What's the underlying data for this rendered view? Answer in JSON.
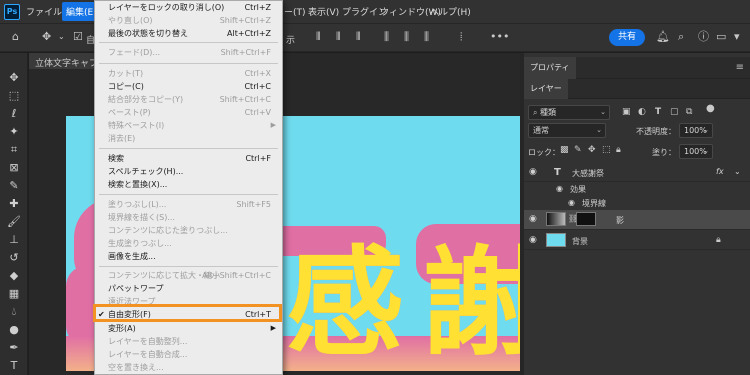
{
  "app": {
    "logo": "Ps"
  },
  "menubar": {
    "items": [
      "ファイル(F)",
      "編集(E)",
      "ー(T)",
      "表示(V)",
      "プラグイン",
      "ウィンドウ(W)",
      "ヘルプ(H)"
    ]
  },
  "options_bar": {
    "auto_label": "自",
    "show_label": "示",
    "share_label": "共有",
    "icons": [
      "home-icon",
      "move-icon",
      "checkbox-icon",
      "align-icons",
      "more-icon",
      "bell-icon",
      "search-icon",
      "help-icon",
      "workspace-icon",
      "panels-icon"
    ]
  },
  "document": {
    "tab_label": "立体文字キャプチ",
    "canvas_text": "感謝",
    "colors": {
      "background": "#6fdbee",
      "shape": "#e06fa4",
      "text": "#ffe033"
    }
  },
  "edit_menu": {
    "items": [
      {
        "label": "レイヤーをロックの取り消し(O)",
        "shortcut": "Ctrl+Z",
        "disabled": false
      },
      {
        "label": "やり直し(O)",
        "shortcut": "Shift+Ctrl+Z",
        "disabled": true
      },
      {
        "label": "最後の状態を切り替え",
        "shortcut": "Alt+Ctrl+Z",
        "disabled": false
      },
      {
        "label": "フェード(D)...",
        "shortcut": "Shift+Ctrl+F",
        "disabled": true
      },
      {
        "label": "カット(T)",
        "shortcut": "Ctrl+X",
        "disabled": true
      },
      {
        "label": "コピー(C)",
        "shortcut": "Ctrl+C",
        "disabled": false
      },
      {
        "label": "結合部分をコピー(Y)",
        "shortcut": "Shift+Ctrl+C",
        "disabled": true
      },
      {
        "label": "ペースト(P)",
        "shortcut": "Ctrl+V",
        "disabled": true
      },
      {
        "label": "特殊ペースト(I)",
        "shortcut": "",
        "disabled": true,
        "submenu": true
      },
      {
        "label": "消去(E)",
        "shortcut": "",
        "disabled": true
      },
      {
        "label": "検索",
        "shortcut": "Ctrl+F",
        "disabled": false
      },
      {
        "label": "スペルチェック(H)...",
        "shortcut": "",
        "disabled": false
      },
      {
        "label": "検索と置換(X)...",
        "shortcut": "",
        "disabled": false
      },
      {
        "label": "塗りつぶし(L)...",
        "shortcut": "Shift+F5",
        "disabled": true
      },
      {
        "label": "境界線を描く(S)...",
        "shortcut": "",
        "disabled": true
      },
      {
        "label": "コンテンツに応じた塗りつぶし...",
        "shortcut": "",
        "disabled": true
      },
      {
        "label": "生成塗りつぶし...",
        "shortcut": "",
        "disabled": true
      },
      {
        "label": "画像を生成...",
        "shortcut": "",
        "disabled": false
      },
      {
        "label": "コンテンツに応じて拡大・縮小",
        "shortcut": "Alt+Shift+Ctrl+C",
        "disabled": true
      },
      {
        "label": "パペットワープ",
        "shortcut": "",
        "disabled": false
      },
      {
        "label": "遠近法ワープ",
        "shortcut": "",
        "disabled": true
      },
      {
        "label": "自由変形(F)",
        "shortcut": "Ctrl+T",
        "disabled": false,
        "checked": true
      },
      {
        "label": "変形(A)",
        "shortcut": "",
        "disabled": false,
        "submenu": true
      },
      {
        "label": "レイヤーを自動整列...",
        "shortcut": "",
        "disabled": true
      },
      {
        "label": "レイヤーを自動合成...",
        "shortcut": "",
        "disabled": true
      },
      {
        "label": "空を置き換え...",
        "shortcut": "",
        "disabled": true
      }
    ],
    "highlight_color": "#f29223"
  },
  "properties_panel": {
    "tab_label": "プロパティ"
  },
  "layers_panel": {
    "tab_label": "レイヤー",
    "filter_value": "種類",
    "blend_mode": "通常",
    "opacity_label": "不透明度：",
    "opacity_value": "100%",
    "lock_label": "ロック：",
    "fill_label": "塗り：",
    "fill_value": "100%",
    "layers": [
      {
        "name": "大感謝祭",
        "type": "text",
        "fx": "fx"
      },
      {
        "name": "効果",
        "type": "effect"
      },
      {
        "name": "境界線",
        "type": "effect-item"
      },
      {
        "name": "影",
        "type": "raster",
        "selected": true
      },
      {
        "name": "背景",
        "type": "background",
        "locked": true
      }
    ]
  }
}
